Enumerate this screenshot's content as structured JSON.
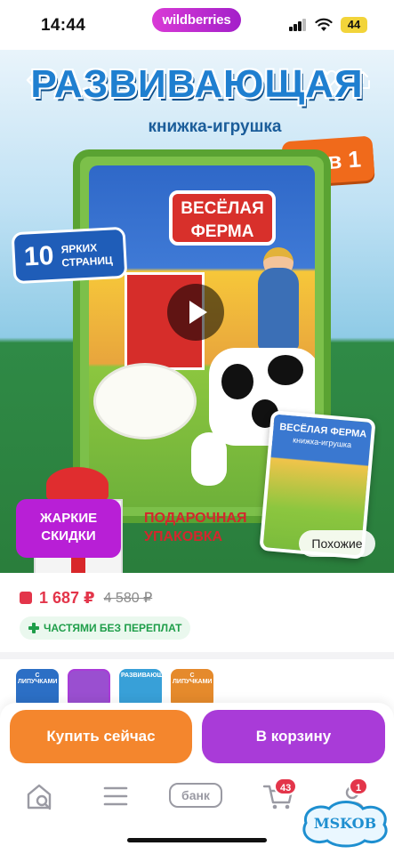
{
  "status_bar": {
    "time": "14:44",
    "app_pill": "wildberries",
    "battery": "44"
  },
  "hero": {
    "title": "РАЗВИВАЮЩАЯ",
    "subtitle": "книжка-игрушка",
    "badge_20": "20 в 1",
    "book_sign_line1": "ВЕСЁЛАЯ",
    "book_sign_line2": "ФЕРМА",
    "badge_10_num": "10",
    "badge_10_text": "ЯРКИХ СТРАНИЦ",
    "sale_line1": "ЖАРКИЕ",
    "sale_line2": "СКИДКИ",
    "gift_line1": "ПОДАРОЧНАЯ",
    "gift_line2": "УПАКОВКА",
    "thumb_title": "ВЕСЁЛАЯ ФЕРМА",
    "thumb_sub": "книжка-игрушка",
    "similar_button": "Похожие"
  },
  "product": {
    "price_now": "1 687 ₽",
    "price_old": "4 580 ₽",
    "installment": "ЧАСТЯМИ БЕЗ ПЕРЕПЛАТ"
  },
  "variants": [
    {
      "label": "С ЛИПУЧКАМИ",
      "color": "#2c6fc5"
    },
    {
      "label": "",
      "color": "#9a4fd0"
    },
    {
      "label": "РАЗВИВАЮЩАЯ",
      "color": "#38a0d8"
    },
    {
      "label": "С ЛИПУЧКАМИ",
      "color": "#e58a2c"
    }
  ],
  "actions": {
    "buy_now": "Купить сейчас",
    "add_to_cart": "В корзину"
  },
  "tabbar": {
    "bank": "банк",
    "cart_count": "43",
    "profile_count": "1"
  },
  "watermark": "MSKOB",
  "colors": {
    "brand": "#a93bd8",
    "buy": "#f4862d",
    "price": "#e3354a",
    "installment": "#1f9e4a"
  }
}
